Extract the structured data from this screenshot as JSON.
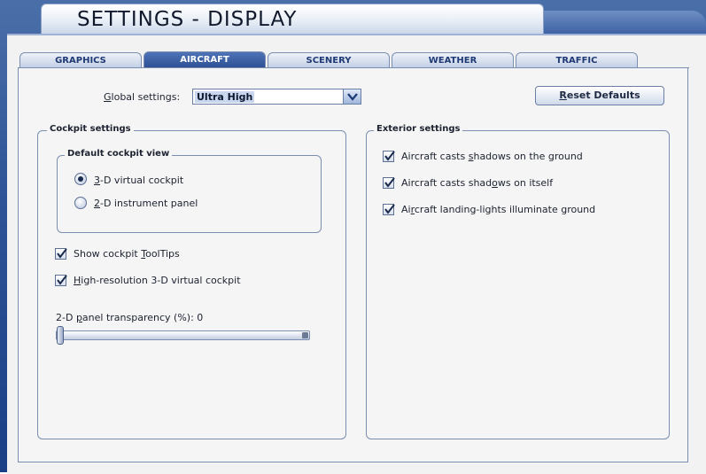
{
  "window": {
    "title": "SETTINGS - DISPLAY"
  },
  "tabs": [
    {
      "label": "GRAPHICS",
      "active": false
    },
    {
      "label": "AIRCRAFT",
      "active": true
    },
    {
      "label": "SCENERY",
      "active": false
    },
    {
      "label": "WEATHER",
      "active": false
    },
    {
      "label": "TRAFFIC",
      "active": false
    }
  ],
  "global": {
    "label_prefix": "G",
    "label_rest": "lobal settings:",
    "value": "Ultra High",
    "dropdown_icon": "chevron-down-icon"
  },
  "reset_button": {
    "first": "R",
    "rest": "eset Defaults"
  },
  "cockpit": {
    "title": "Cockpit settings",
    "default_view": {
      "title": "Default cockpit view",
      "options": [
        {
          "u": "3",
          "rest": "-D virtual cockpit",
          "selected": true
        },
        {
          "u": "2",
          "rest": "-D instrument panel",
          "selected": false
        }
      ]
    },
    "checks": [
      {
        "pre": "Show cockpit ",
        "u": "T",
        "post": "oolTips",
        "checked": true
      },
      {
        "pre": "",
        "u": "H",
        "post": "igh-resolution 3-D virtual cockpit",
        "checked": true
      }
    ],
    "transparency": {
      "pre": "2-D ",
      "u": "p",
      "post": "anel transparency (%): 0",
      "value": 0
    }
  },
  "exterior": {
    "title": "Exterior settings",
    "checks": [
      {
        "pre": "Aircraft casts ",
        "u": "s",
        "post": "hadows on the ground",
        "checked": true
      },
      {
        "pre": "Aircraft casts shad",
        "u": "o",
        "post": "ws on itself",
        "checked": true
      },
      {
        "pre": "Ai",
        "u": "r",
        "post": "craft landing-lights illuminate ground",
        "checked": true
      }
    ]
  },
  "colors": {
    "frame": "#2f5497",
    "tab_active": "#3d62a5",
    "panel": "#f5f5f5"
  }
}
